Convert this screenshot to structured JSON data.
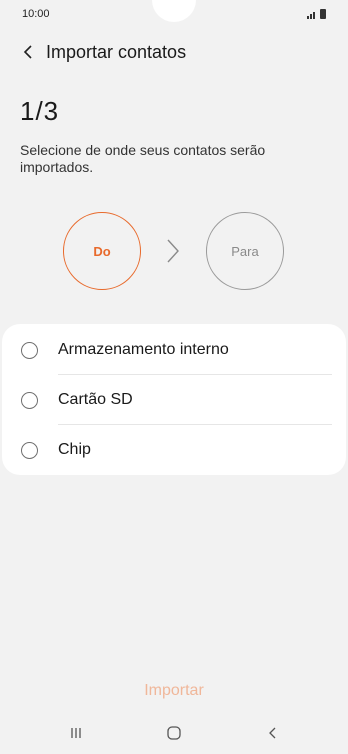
{
  "status_bar": {
    "time": "10:00",
    "icons": [
      "signal-icon",
      "battery-icon"
    ]
  },
  "header": {
    "back_icon": "chevron-left-icon",
    "title": "Importar contatos"
  },
  "step": {
    "counter": "1/3",
    "instruction": "Selecione de onde seus contatos serão importados."
  },
  "flow": {
    "from_label": "Do",
    "to_label": "Para",
    "arrow_icon": "chevron-right-icon",
    "active_color": "#e86a2c",
    "inactive_color": "#9a9a9a"
  },
  "options": [
    {
      "label": "Armazenamento interno",
      "selected": false
    },
    {
      "label": "Cartão SD",
      "selected": false
    },
    {
      "label": "Chip",
      "selected": false
    }
  ],
  "footer": {
    "import_label": "Importar",
    "import_color": "#f0b79a"
  },
  "nav": {
    "recent_icon": "recent-apps-icon",
    "home_icon": "home-icon",
    "back_icon": "back-icon"
  }
}
